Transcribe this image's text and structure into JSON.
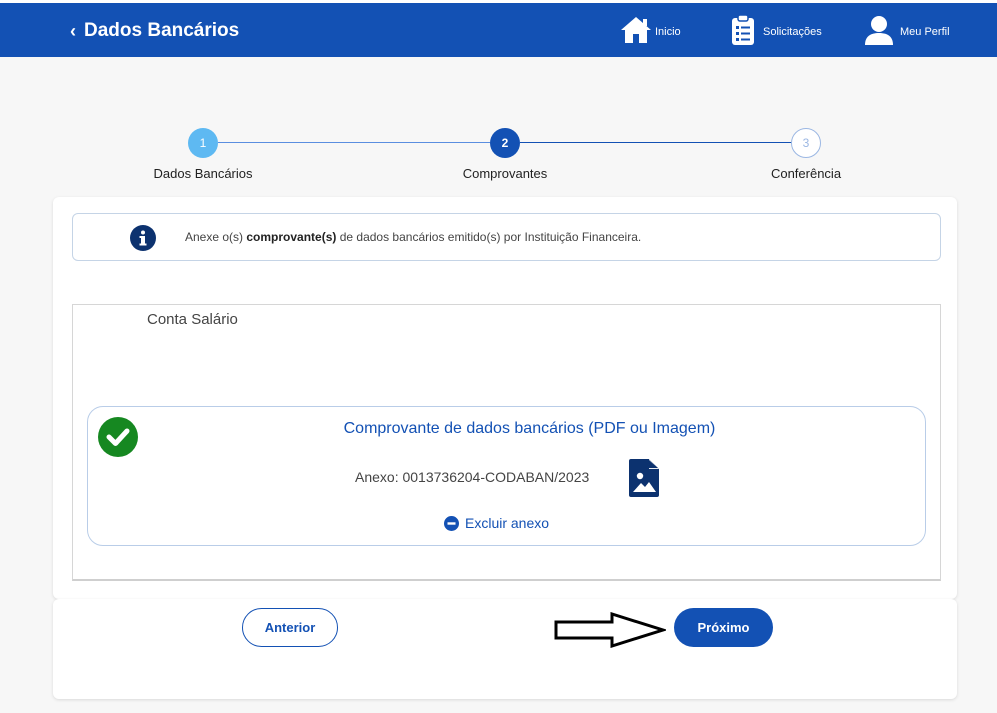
{
  "header": {
    "back_icon": "chevron-left-icon",
    "title": "Dados Bancários",
    "nav": [
      {
        "label": "Inicio",
        "icon": "home-icon"
      },
      {
        "label": "Solicitações",
        "icon": "clipboard-list-icon"
      },
      {
        "label": "Meu Perfil",
        "icon": "user-icon"
      }
    ]
  },
  "stepper": {
    "steps": [
      {
        "number": "1",
        "label": "Dados Bancários",
        "state": "completed"
      },
      {
        "number": "2",
        "label": "Comprovantes",
        "state": "active"
      },
      {
        "number": "3",
        "label": "Conferência",
        "state": "pending"
      }
    ]
  },
  "info": {
    "icon": "info-icon",
    "text_before": "Anexe o(s) ",
    "text_bold": "comprovante(s)",
    "text_after": " de dados bancários emitido(s) por Instituição Financeira."
  },
  "section": {
    "title": "Conta Salário",
    "attachment": {
      "status_icon": "check-circle-icon",
      "title": "Comprovante de dados bancários (PDF ou Imagem)",
      "file_label": "Anexo: 0013736204-CODABAN/2023",
      "file_icon": "file-image-icon",
      "remove_icon": "minus-circle-icon",
      "remove_label": "Excluir anexo"
    }
  },
  "footer": {
    "prev_label": "Anterior",
    "next_label": "Próximo",
    "annotation_icon": "arrow-right-outline-icon"
  },
  "colors": {
    "primary": "#1351b4",
    "step_done": "#5eb9f2",
    "success": "#168821",
    "background": "#f7f7f7"
  }
}
